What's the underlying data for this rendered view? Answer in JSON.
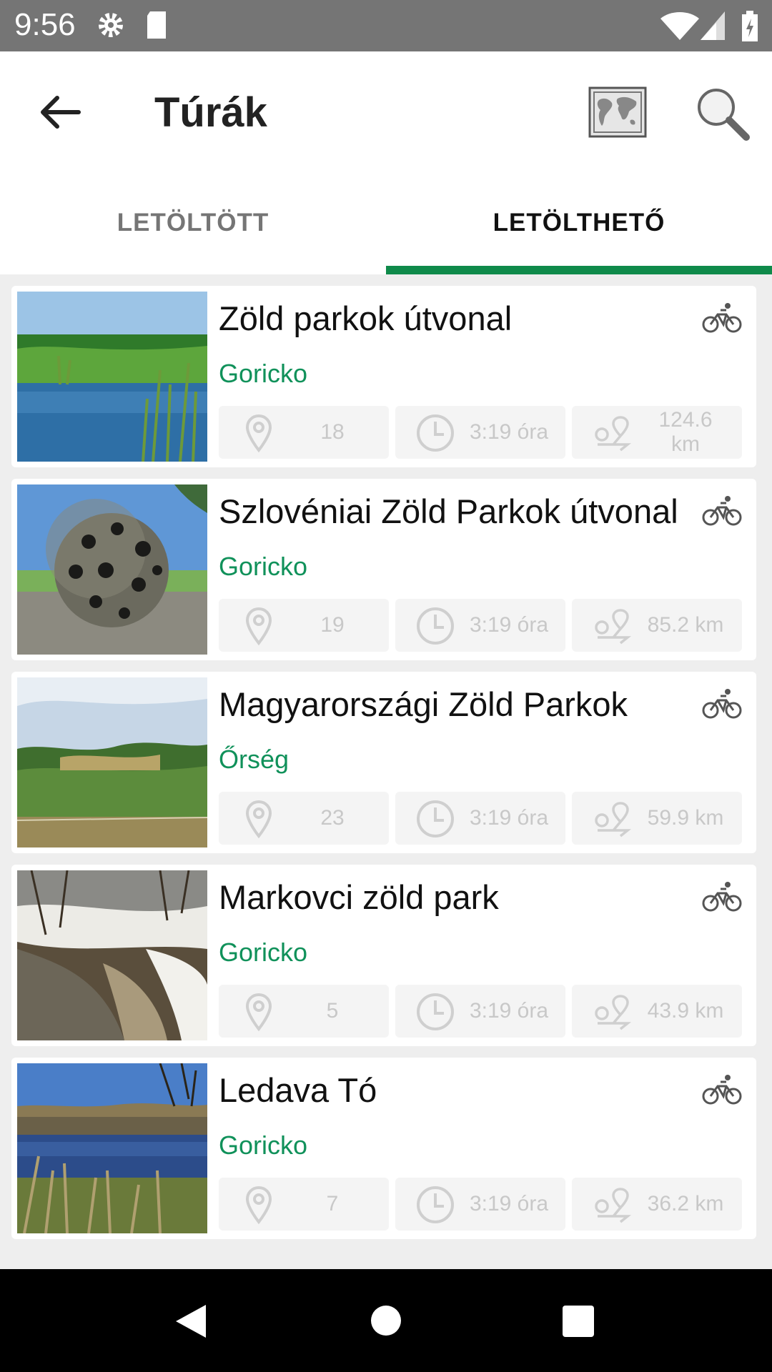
{
  "status_bar": {
    "time": "9:56"
  },
  "header": {
    "title": "Túrák"
  },
  "tabs": [
    {
      "label": "LETÖLTÖTT",
      "active": false
    },
    {
      "label": "LETÖLTHETŐ",
      "active": true
    }
  ],
  "colors": {
    "accent": "#0f8a4a",
    "region": "#10915a"
  },
  "tours": [
    {
      "title": "Zöld parkok útvonal",
      "region": "Goricko",
      "points": "18",
      "duration": "3:19 óra",
      "distance": "124.6 km",
      "type_icon": "bicycle-icon"
    },
    {
      "title": "Szlovéniai Zöld Parkok útvonal",
      "region": "Goricko",
      "points": "19",
      "duration": "3:19 óra",
      "distance": "85.2 km",
      "type_icon": "bicycle-icon"
    },
    {
      "title": "Magyarországi Zöld Parkok",
      "region": "Őrség",
      "points": "23",
      "duration": "3:19 óra",
      "distance": "59.9 km",
      "type_icon": "bicycle-icon"
    },
    {
      "title": "Markovci zöld park",
      "region": "Goricko",
      "points": "5",
      "duration": "3:19 óra",
      "distance": "43.9 km",
      "type_icon": "bicycle-icon"
    },
    {
      "title": "Ledava Tó",
      "region": "Goricko",
      "points": "7",
      "duration": "3:19 óra",
      "distance": "36.2 km",
      "type_icon": "bicycle-icon"
    }
  ]
}
